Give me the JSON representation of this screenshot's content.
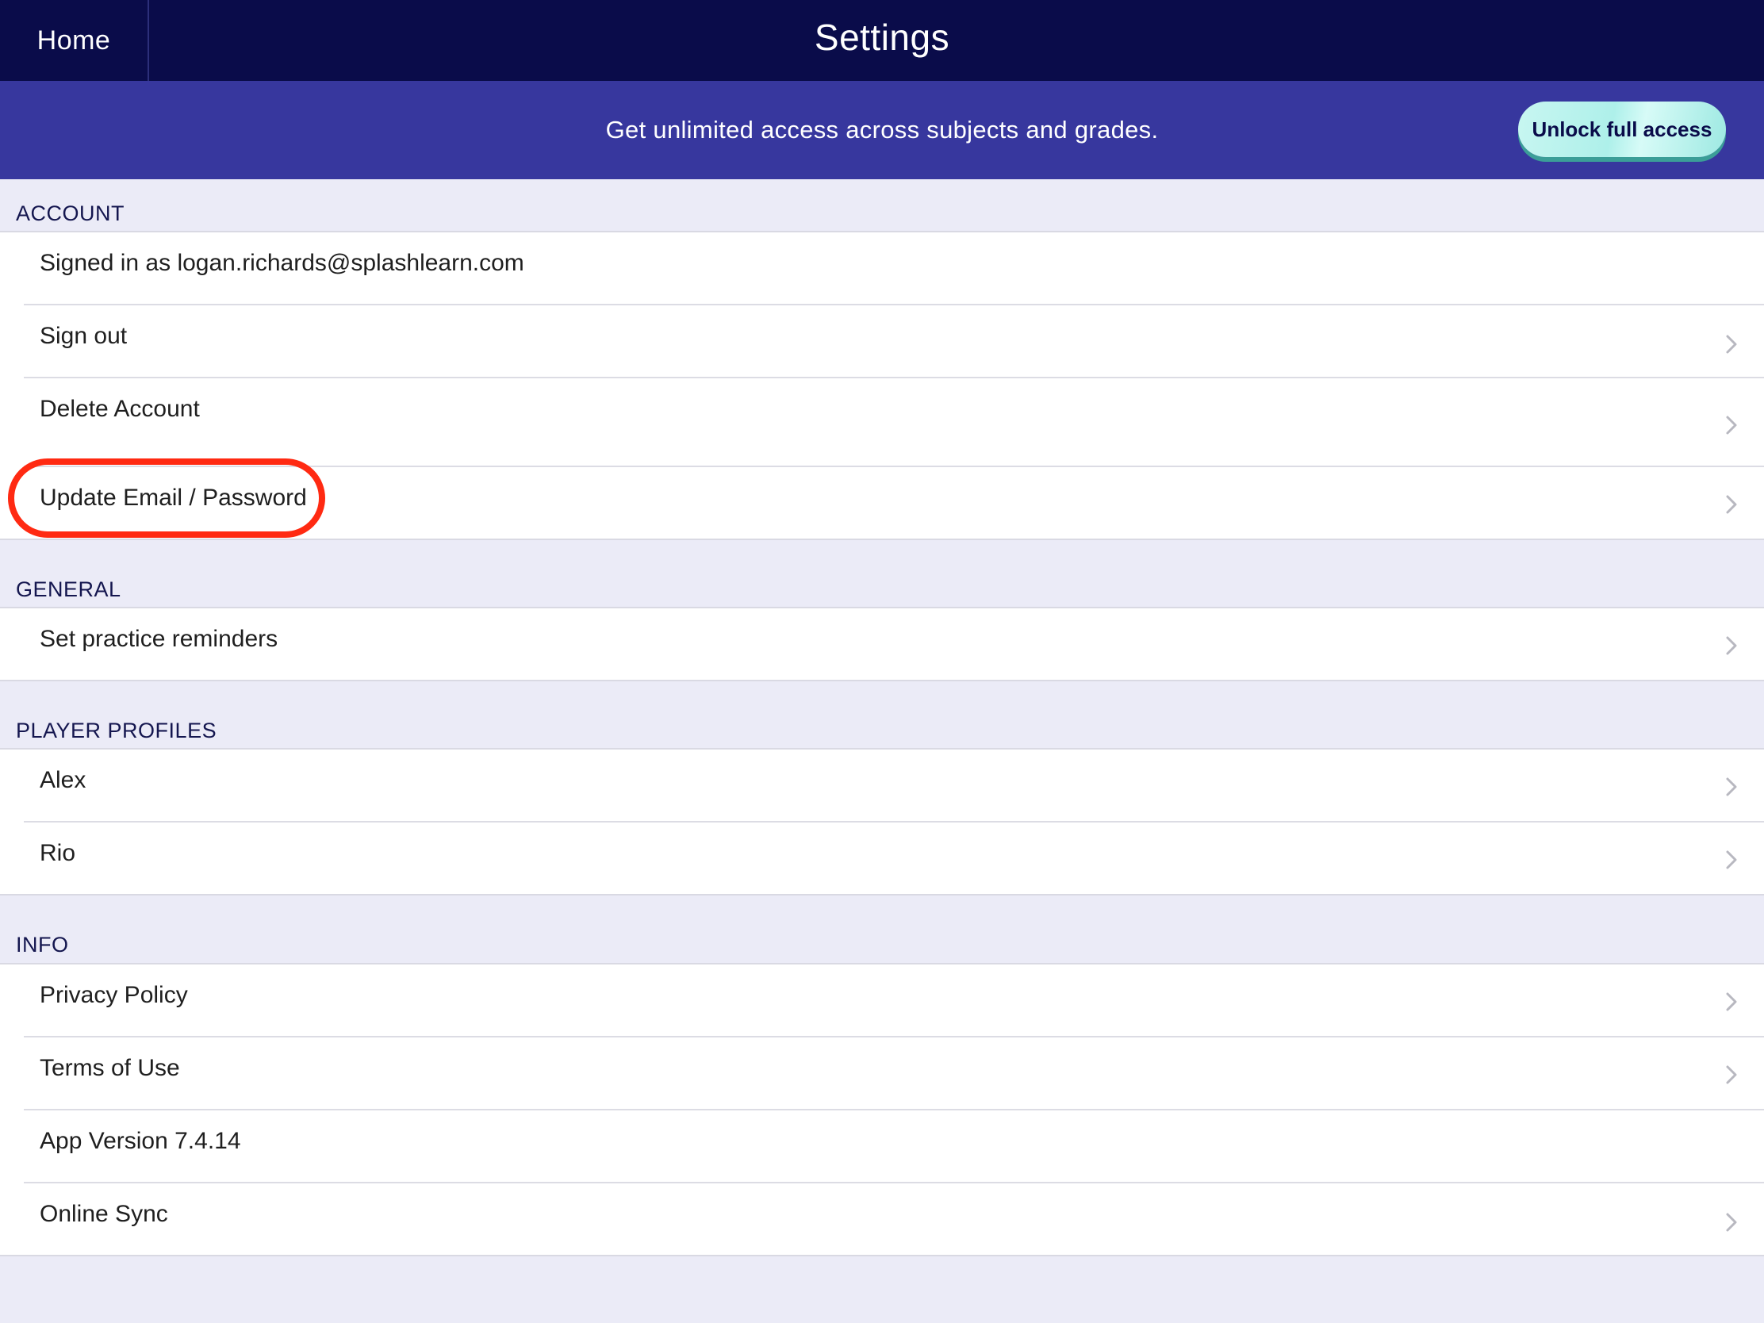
{
  "topbar": {
    "home_label": "Home",
    "title": "Settings"
  },
  "banner": {
    "text": "Get unlimited access across subjects and grades.",
    "cta_label": "Unlock full access"
  },
  "sections": {
    "account": {
      "title": "ACCOUNT",
      "signed_in": "Signed in as logan.richards@splashlearn.com",
      "sign_out": "Sign out",
      "delete_account": "Delete Account",
      "update_email_password": "Update Email / Password"
    },
    "general": {
      "title": "GENERAL",
      "reminders": "Set practice reminders"
    },
    "profiles": {
      "title": "PLAYER PROFILES",
      "players": [
        "Alex",
        "Rio"
      ]
    },
    "info": {
      "title": "INFO",
      "privacy": "Privacy Policy",
      "terms": "Terms of Use",
      "version": "App Version 7.4.14",
      "sync": "Online Sync"
    }
  },
  "icons": {
    "row_chevron": "chevron-right-icon"
  },
  "colors": {
    "header": "#0a0c4a",
    "banner": "#37379e",
    "cta": "#aef0ea",
    "highlight": "#ff2a12"
  }
}
